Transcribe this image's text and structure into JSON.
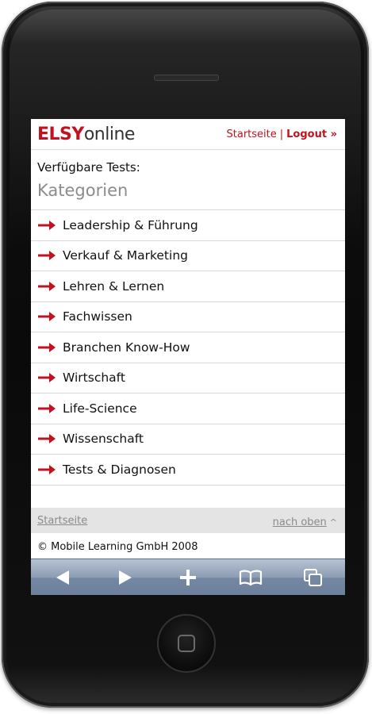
{
  "header": {
    "logo_part1": "ELSY",
    "logo_part2": "online",
    "home_link": "Startseite",
    "separator": "|",
    "logout_link": "Logout »"
  },
  "main": {
    "available_label": "Verfügbare Tests:",
    "category_heading": "Kategorien",
    "categories": [
      {
        "label": "Leadership & Führung"
      },
      {
        "label": "Verkauf & Marketing"
      },
      {
        "label": "Lehren & Lernen"
      },
      {
        "label": "Fachwissen"
      },
      {
        "label": "Branchen Know-How"
      },
      {
        "label": "Wirtschaft"
      },
      {
        "label": "Life-Science"
      },
      {
        "label": "Wissenschaft"
      },
      {
        "label": "Tests & Diagnosen"
      }
    ]
  },
  "footer": {
    "home_link": "Startseite",
    "top_link": "nach oben",
    "top_icon": "^",
    "copyright": "© Mobile Learning GmbH 2008"
  },
  "toolbar": {
    "icons": [
      "back-icon",
      "forward-icon",
      "add-icon",
      "bookmarks-icon",
      "pages-icon"
    ]
  },
  "colors": {
    "brand_red": "#c1121f",
    "toolbar_blue": "#7588a3"
  }
}
